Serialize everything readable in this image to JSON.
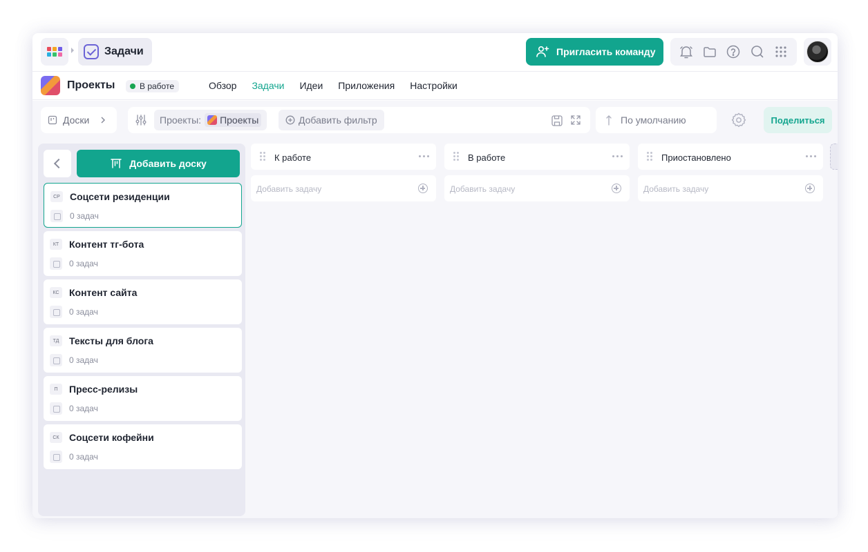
{
  "topbar": {
    "app_title": "Задачи",
    "invite_label": "Пригласить команду",
    "icons": [
      "bell-icon",
      "folder-icon",
      "help-icon",
      "search-icon",
      "apps-grid-icon"
    ],
    "brand_grid_colors": [
      "#e94b5b",
      "#f5a623",
      "#6f5ce8",
      "#2ab0e0",
      "#37c36b",
      "#f06aa7"
    ]
  },
  "project": {
    "title": "Проекты",
    "status": "В работе",
    "status_color": "#18a451",
    "nav": [
      {
        "label": "Обзор",
        "active": false
      },
      {
        "label": "Задачи",
        "active": true
      },
      {
        "label": "Идеи",
        "active": false
      },
      {
        "label": "Приложения",
        "active": false
      },
      {
        "label": "Настройки",
        "active": false
      }
    ]
  },
  "toolbar": {
    "boards_label": "Доски",
    "filter_prefix": "Проекты:",
    "filter_value": "Проекты",
    "add_filter_label": "Добавить фильтр",
    "sort_label": "По умолчанию",
    "share_label": "Поделиться"
  },
  "sidebar": {
    "add_board_label": "Добавить доску",
    "boards": [
      {
        "abbr": "СР",
        "name": "Соцсети резиденции",
        "count": "0 задач",
        "selected": true
      },
      {
        "abbr": "КТ",
        "name": "Контент тг-бота",
        "count": "0 задач",
        "selected": false
      },
      {
        "abbr": "КС",
        "name": "Контент сайта",
        "count": "0 задач",
        "selected": false
      },
      {
        "abbr": "ТД",
        "name": "Тексты для блога",
        "count": "0 задач",
        "selected": false
      },
      {
        "abbr": "П",
        "name": "Пресс-релизы",
        "count": "0 задач",
        "selected": false
      },
      {
        "abbr": "СК",
        "name": "Соцсети кофейни",
        "count": "0 задач",
        "selected": false
      }
    ]
  },
  "columns": [
    {
      "title": "К работе",
      "add_placeholder": "Добавить задачу"
    },
    {
      "title": "В работе",
      "add_placeholder": "Добавить задачу"
    },
    {
      "title": "Приостановлено",
      "add_placeholder": "Добавить задачу"
    }
  ],
  "colors": {
    "accent": "#12a58e",
    "accent_light": "#e1f4f0",
    "brand_purple": "#6b63d6"
  }
}
